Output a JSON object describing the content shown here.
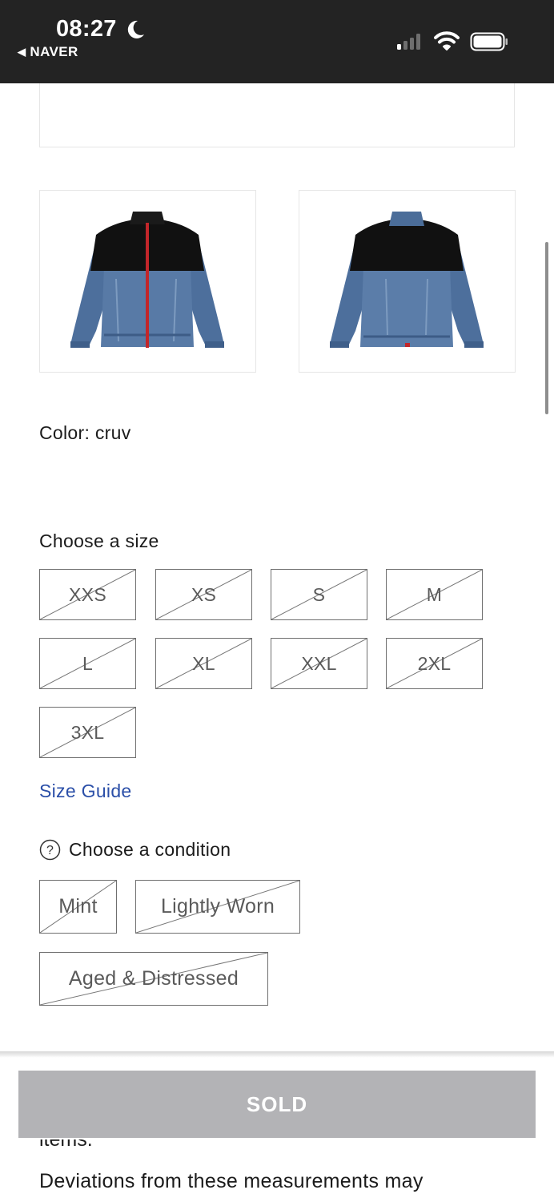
{
  "status_bar": {
    "time": "08:27",
    "back_app": "NAVER",
    "icons": [
      "moon-icon",
      "cellular-signal-icon",
      "wifi-icon",
      "battery-icon"
    ]
  },
  "product": {
    "image_front_alt": "Denim jacket front view",
    "image_back_alt": "Denim jacket back view",
    "color_label": "Color: cruv"
  },
  "sizes": {
    "title": "Choose a size",
    "options": [
      {
        "label": "XXS",
        "available": false
      },
      {
        "label": "XS",
        "available": false
      },
      {
        "label": "S",
        "available": false
      },
      {
        "label": "M",
        "available": false
      },
      {
        "label": "L",
        "available": false
      },
      {
        "label": "XL",
        "available": false
      },
      {
        "label": "XXL",
        "available": false
      },
      {
        "label": "2XL",
        "available": false
      },
      {
        "label": "3XL",
        "available": false
      }
    ],
    "guide_link": "Size Guide"
  },
  "condition": {
    "title": "Choose a condition",
    "help_icon": "question-circle-icon",
    "options": [
      {
        "label": "Mint",
        "available": false
      },
      {
        "label": "Lightly Worn",
        "available": false
      },
      {
        "label": "Aged & Distressed",
        "available": false
      }
    ]
  },
  "cta": {
    "label": "SOLD"
  },
  "description": {
    "clipped_line": "items.",
    "line": "Deviations from these measurements may"
  },
  "colors": {
    "status_bar_bg": "#232323",
    "link": "#2b4fa8",
    "sold_button_bg": "#b3b3b6",
    "border": "#6f6f6f"
  }
}
